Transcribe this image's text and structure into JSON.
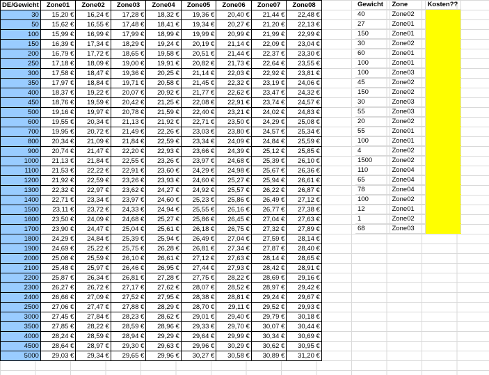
{
  "rate_table": {
    "headers": [
      "DE/Gewicht",
      "Zone01",
      "Zone02",
      "Zone03",
      "Zone04",
      "Zone05",
      "Zone06",
      "Zone07",
      "Zone08"
    ],
    "rows": [
      {
        "w": "30",
        "p": [
          "15,20 €",
          "16,24 €",
          "17,28 €",
          "18,32 €",
          "19,36 €",
          "20,40 €",
          "21,44 €",
          "22,48 €"
        ]
      },
      {
        "w": "50",
        "p": [
          "15,62 €",
          "16,55 €",
          "17,48 €",
          "18,41 €",
          "19,34 €",
          "20,27 €",
          "21,20 €",
          "22,13 €"
        ]
      },
      {
        "w": "100",
        "p": [
          "15,99 €",
          "16,99 €",
          "17,99 €",
          "18,99 €",
          "19,99 €",
          "20,99 €",
          "21,99 €",
          "22,99 €"
        ]
      },
      {
        "w": "150",
        "p": [
          "16,39 €",
          "17,34 €",
          "18,29 €",
          "19,24 €",
          "20,19 €",
          "21,14 €",
          "22,09 €",
          "23,04 €"
        ]
      },
      {
        "w": "200",
        "p": [
          "16,79 €",
          "17,72 €",
          "18,65 €",
          "19,58 €",
          "20,51 €",
          "21,44 €",
          "22,37 €",
          "23,30 €"
        ]
      },
      {
        "w": "250",
        "p": [
          "17,18 €",
          "18,09 €",
          "19,00 €",
          "19,91 €",
          "20,82 €",
          "21,73 €",
          "22,64 €",
          "23,55 €"
        ]
      },
      {
        "w": "300",
        "p": [
          "17,58 €",
          "18,47 €",
          "19,36 €",
          "20,25 €",
          "21,14 €",
          "22,03 €",
          "22,92 €",
          "23,81 €"
        ]
      },
      {
        "w": "350",
        "p": [
          "17,97 €",
          "18,84 €",
          "19,71 €",
          "20,58 €",
          "21,45 €",
          "22,32 €",
          "23,19 €",
          "24,06 €"
        ]
      },
      {
        "w": "400",
        "p": [
          "18,37 €",
          "19,22 €",
          "20,07 €",
          "20,92 €",
          "21,77 €",
          "22,62 €",
          "23,47 €",
          "24,32 €"
        ]
      },
      {
        "w": "450",
        "p": [
          "18,76 €",
          "19,59 €",
          "20,42 €",
          "21,25 €",
          "22,08 €",
          "22,91 €",
          "23,74 €",
          "24,57 €"
        ]
      },
      {
        "w": "500",
        "p": [
          "19,16 €",
          "19,97 €",
          "20,78 €",
          "21,59 €",
          "22,40 €",
          "23,21 €",
          "24,02 €",
          "24,83 €"
        ]
      },
      {
        "w": "600",
        "p": [
          "19,55 €",
          "20,34 €",
          "21,13 €",
          "21,92 €",
          "22,71 €",
          "23,50 €",
          "24,29 €",
          "25,08 €"
        ]
      },
      {
        "w": "700",
        "p": [
          "19,95 €",
          "20,72 €",
          "21,49 €",
          "22,26 €",
          "23,03 €",
          "23,80 €",
          "24,57 €",
          "25,34 €"
        ]
      },
      {
        "w": "800",
        "p": [
          "20,34 €",
          "21,09 €",
          "21,84 €",
          "22,59 €",
          "23,34 €",
          "24,09 €",
          "24,84 €",
          "25,59 €"
        ]
      },
      {
        "w": "900",
        "p": [
          "20,74 €",
          "21,47 €",
          "22,20 €",
          "22,93 €",
          "23,66 €",
          "24,39 €",
          "25,12 €",
          "25,85 €"
        ]
      },
      {
        "w": "1000",
        "p": [
          "21,13 €",
          "21,84 €",
          "22,55 €",
          "23,26 €",
          "23,97 €",
          "24,68 €",
          "25,39 €",
          "26,10 €"
        ]
      },
      {
        "w": "1100",
        "p": [
          "21,53 €",
          "22,22 €",
          "22,91 €",
          "23,60 €",
          "24,29 €",
          "24,98 €",
          "25,67 €",
          "26,36 €"
        ]
      },
      {
        "w": "1200",
        "p": [
          "21,92 €",
          "22,59 €",
          "23,26 €",
          "23,93 €",
          "24,60 €",
          "25,27 €",
          "25,94 €",
          "26,61 €"
        ]
      },
      {
        "w": "1300",
        "p": [
          "22,32 €",
          "22,97 €",
          "23,62 €",
          "24,27 €",
          "24,92 €",
          "25,57 €",
          "26,22 €",
          "26,87 €"
        ]
      },
      {
        "w": "1400",
        "p": [
          "22,71 €",
          "23,34 €",
          "23,97 €",
          "24,60 €",
          "25,23 €",
          "25,86 €",
          "26,49 €",
          "27,12 €"
        ]
      },
      {
        "w": "1500",
        "p": [
          "23,11 €",
          "23,72 €",
          "24,33 €",
          "24,94 €",
          "25,55 €",
          "26,16 €",
          "26,77 €",
          "27,38 €"
        ]
      },
      {
        "w": "1600",
        "p": [
          "23,50 €",
          "24,09 €",
          "24,68 €",
          "25,27 €",
          "25,86 €",
          "26,45 €",
          "27,04 €",
          "27,63 €"
        ]
      },
      {
        "w": "1700",
        "p": [
          "23,90 €",
          "24,47 €",
          "25,04 €",
          "25,61 €",
          "26,18 €",
          "26,75 €",
          "27,32 €",
          "27,89 €"
        ]
      },
      {
        "w": "1800",
        "p": [
          "24,29 €",
          "24,84 €",
          "25,39 €",
          "25,94 €",
          "26,49 €",
          "27,04 €",
          "27,59 €",
          "28,14 €"
        ]
      },
      {
        "w": "1900",
        "p": [
          "24,69 €",
          "25,22 €",
          "25,75 €",
          "26,28 €",
          "26,81 €",
          "27,34 €",
          "27,87 €",
          "28,40 €"
        ]
      },
      {
        "w": "2000",
        "p": [
          "25,08 €",
          "25,59 €",
          "26,10 €",
          "26,61 €",
          "27,12 €",
          "27,63 €",
          "28,14 €",
          "28,65 €"
        ]
      },
      {
        "w": "2100",
        "p": [
          "25,48 €",
          "25,97 €",
          "26,46 €",
          "26,95 €",
          "27,44 €",
          "27,93 €",
          "28,42 €",
          "28,91 €"
        ]
      },
      {
        "w": "2200",
        "p": [
          "25,87 €",
          "26,34 €",
          "26,81 €",
          "27,28 €",
          "27,75 €",
          "28,22 €",
          "28,69 €",
          "29,16 €"
        ]
      },
      {
        "w": "2300",
        "p": [
          "26,27 €",
          "26,72 €",
          "27,17 €",
          "27,62 €",
          "28,07 €",
          "28,52 €",
          "28,97 €",
          "29,42 €"
        ]
      },
      {
        "w": "2400",
        "p": [
          "26,66 €",
          "27,09 €",
          "27,52 €",
          "27,95 €",
          "28,38 €",
          "28,81 €",
          "29,24 €",
          "29,67 €"
        ]
      },
      {
        "w": "2500",
        "p": [
          "27,06 €",
          "27,47 €",
          "27,88 €",
          "28,29 €",
          "28,70 €",
          "29,11 €",
          "29,52 €",
          "29,93 €"
        ]
      },
      {
        "w": "3000",
        "p": [
          "27,45 €",
          "27,84 €",
          "28,23 €",
          "28,62 €",
          "29,01 €",
          "29,40 €",
          "29,79 €",
          "30,18 €"
        ]
      },
      {
        "w": "3500",
        "p": [
          "27,85 €",
          "28,22 €",
          "28,59 €",
          "28,96 €",
          "29,33 €",
          "29,70 €",
          "30,07 €",
          "30,44 €"
        ]
      },
      {
        "w": "4000",
        "p": [
          "28,24 €",
          "28,59 €",
          "28,94 €",
          "29,29 €",
          "29,64 €",
          "29,99 €",
          "30,34 €",
          "30,69 €"
        ]
      },
      {
        "w": "4500",
        "p": [
          "28,64 €",
          "28,97 €",
          "29,30 €",
          "29,63 €",
          "29,96 €",
          "30,29 €",
          "30,62 €",
          "30,95 €"
        ]
      },
      {
        "w": "5000",
        "p": [
          "29,03 €",
          "29,34 €",
          "29,65 €",
          "29,96 €",
          "30,27 €",
          "30,58 €",
          "30,89 €",
          "31,20 €"
        ]
      }
    ]
  },
  "lookup_table": {
    "headers": [
      "Gewicht",
      "Zone",
      "Kosten??"
    ],
    "highlight_color": "#ffff00",
    "weight_column_color": "#99ccff",
    "rows": [
      {
        "gewicht": "40",
        "zone": "Zone02"
      },
      {
        "gewicht": "27",
        "zone": "Zone01"
      },
      {
        "gewicht": "150",
        "zone": "Zone01"
      },
      {
        "gewicht": "30",
        "zone": "Zone02"
      },
      {
        "gewicht": "60",
        "zone": "Zone01"
      },
      {
        "gewicht": "100",
        "zone": "Zone01"
      },
      {
        "gewicht": "100",
        "zone": "Zone03"
      },
      {
        "gewicht": "45",
        "zone": "Zone02"
      },
      {
        "gewicht": "150",
        "zone": "Zone02"
      },
      {
        "gewicht": "30",
        "zone": "Zone03"
      },
      {
        "gewicht": "55",
        "zone": "Zone03"
      },
      {
        "gewicht": "20",
        "zone": "Zone02"
      },
      {
        "gewicht": "55",
        "zone": "Zone01"
      },
      {
        "gewicht": "100",
        "zone": "Zone01"
      },
      {
        "gewicht": "4",
        "zone": "Zone02"
      },
      {
        "gewicht": "1500",
        "zone": "Zone02"
      },
      {
        "gewicht": "110",
        "zone": "Zone04"
      },
      {
        "gewicht": "65",
        "zone": "Zone04"
      },
      {
        "gewicht": "78",
        "zone": "Zone04"
      },
      {
        "gewicht": "100",
        "zone": "Zone02"
      },
      {
        "gewicht": "12",
        "zone": "Zone01"
      },
      {
        "gewicht": "1",
        "zone": "Zone02"
      },
      {
        "gewicht": "68",
        "zone": "Zone03"
      }
    ]
  }
}
